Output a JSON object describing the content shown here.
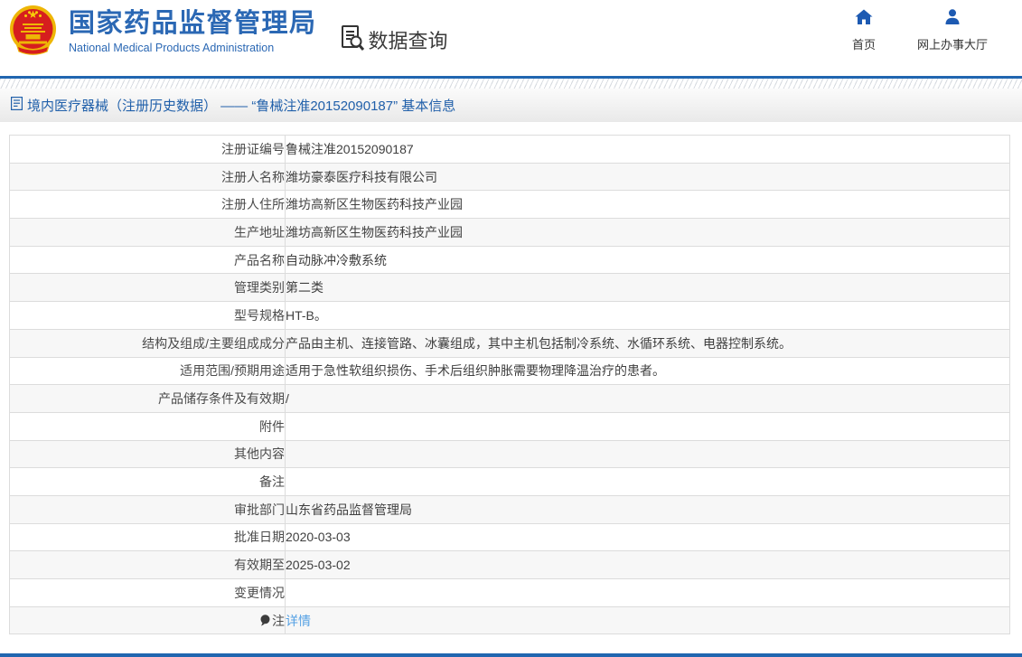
{
  "header": {
    "brand_cn": "国家药品监督管理局",
    "brand_en": "National Medical Products Administration",
    "query_label": "数据查询",
    "nav": [
      {
        "label": "首页",
        "icon": "home-icon"
      },
      {
        "label": "网上办事大厅",
        "icon": "user-icon"
      }
    ]
  },
  "page_title": "境内医疗器械（注册历史数据） —— “鲁械注准20152090187” 基本信息",
  "table": {
    "rows": [
      {
        "label": "注册证编号",
        "value": "鲁械注准20152090187"
      },
      {
        "label": "注册人名称",
        "value": "潍坊豪泰医疗科技有限公司"
      },
      {
        "label": "注册人住所",
        "value": "潍坊高新区生物医药科技产业园"
      },
      {
        "label": "生产地址",
        "value": "潍坊高新区生物医药科技产业园"
      },
      {
        "label": "产品名称",
        "value": "自动脉冲冷敷系统"
      },
      {
        "label": "管理类别",
        "value": "第二类"
      },
      {
        "label": "型号规格",
        "value": "HT-B。"
      },
      {
        "label": "结构及组成/主要组成成分",
        "value": "产品由主机、连接管路、冰囊组成，其中主机包括制冷系统、水循环系统、电器控制系统。"
      },
      {
        "label": "适用范围/预期用途",
        "value": "适用于急性软组织损伤、手术后组织肿胀需要物理降温治疗的患者。"
      },
      {
        "label": "产品储存条件及有效期",
        "value": "/"
      },
      {
        "label": "附件",
        "value": ""
      },
      {
        "label": "其他内容",
        "value": ""
      },
      {
        "label": "备注",
        "value": ""
      },
      {
        "label": "审批部门",
        "value": "山东省药品监督管理局"
      },
      {
        "label": "批准日期",
        "value": "2020-03-03"
      },
      {
        "label": "有效期至",
        "value": "2025-03-02"
      },
      {
        "label": "变更情况",
        "value": ""
      },
      {
        "label": "注",
        "value": "详情"
      }
    ]
  },
  "colors": {
    "brand_blue": "#2b68b4",
    "rule_blue": "#2166b0",
    "title_blue": "#2160aa",
    "link_blue": "#55a1e4",
    "emblem_red": "#d61e1e",
    "emblem_gold": "#eeb606",
    "row_alt_bg": "#f7f7f7",
    "border_gray": "#dcdcdc"
  }
}
